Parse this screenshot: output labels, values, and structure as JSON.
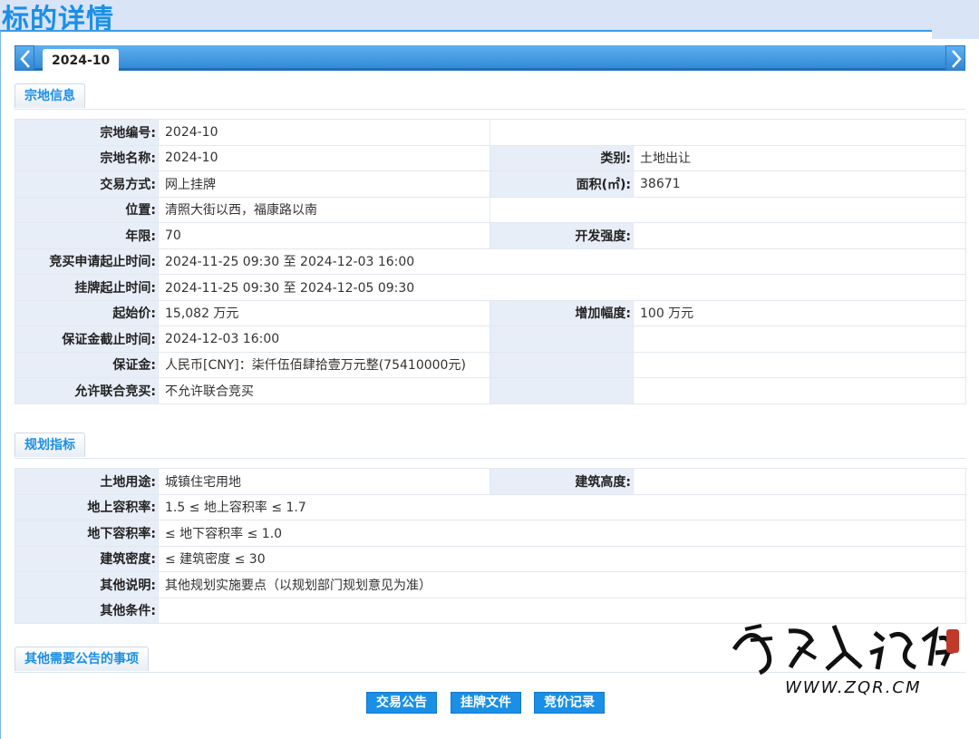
{
  "page": {
    "title": "标的详情"
  },
  "tabs": {
    "active_label": "2024-10"
  },
  "sections": {
    "land_info": "宗地信息",
    "planning": "规划指标",
    "other_notices": "其他需要公告的事项"
  },
  "land_info": {
    "parcel_no_label": "宗地编号:",
    "parcel_no": "2024-10",
    "parcel_name_label": "宗地名称:",
    "parcel_name": "2024-10",
    "category_label": "类别:",
    "category": "土地出让",
    "trade_method_label": "交易方式:",
    "trade_method": "网上挂牌",
    "area_label": "面积(㎡):",
    "area": "38671",
    "location_label": "位置:",
    "location": "清照大街以西，福康路以南",
    "term_label": "年限:",
    "term": "70",
    "intensity_label": "开发强度:",
    "intensity": "",
    "bid_apply_period_label": "竞买申请起止时间:",
    "bid_apply_period": "2024-11-25 09:30 至 2024-12-03 16:00",
    "listing_period_label": "挂牌起止时间:",
    "listing_period": "2024-11-25 09:30 至 2024-12-05 09:30",
    "start_price_label": "起始价:",
    "start_price": "15,082 万元",
    "increment_label": "增加幅度:",
    "increment": "100 万元",
    "deposit_deadline_label": "保证金截止时间:",
    "deposit_deadline": "2024-12-03 16:00",
    "deposit_label": "保证金:",
    "deposit": "人民币[CNY]：柒仟伍佰肆拾壹万元整(75410000元)",
    "joint_bid_label": "允许联合竞买:",
    "joint_bid": "不允许联合竞买"
  },
  "planning": {
    "land_use_label": "土地用途:",
    "land_use": "城镇住宅用地",
    "building_height_label": "建筑高度:",
    "building_height": "",
    "far_above_label": "地上容积率:",
    "far_above": "1.5 ≤ 地上容积率 ≤ 1.7",
    "far_below_label": "地下容积率:",
    "far_below": "≤ 地下容积率 ≤ 1.0",
    "density_label": "建筑密度:",
    "density": "≤ 建筑密度 ≤ 30",
    "other_desc_label": "其他说明:",
    "other_desc": "其他规划实施要点（以规划部门规划意见为准）",
    "other_cond_label": "其他条件:",
    "other_cond": ""
  },
  "buttons": {
    "trade_notice": "交易公告",
    "listing_docs": "挂牌文件",
    "bid_records": "竞价记录"
  },
  "watermark": {
    "calligraphy": "章丘人论坛",
    "url": "WWW.ZQR.CM"
  },
  "colors": {
    "accent": "#1a8fe6",
    "label_bg": "#e8eef7",
    "page_bg": "#d9e4f7"
  }
}
